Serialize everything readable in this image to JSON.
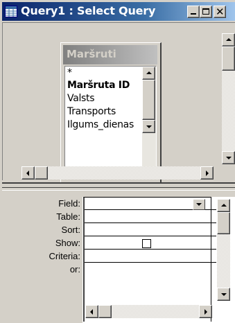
{
  "window": {
    "title": "Query1 : Select Query",
    "close_glyph": "✕"
  },
  "field_list": {
    "title": "Maršruti",
    "items": [
      {
        "label": "*",
        "bold": false
      },
      {
        "label": "Maršruta ID",
        "bold": true
      },
      {
        "label": "Valsts",
        "bold": false
      },
      {
        "label": "Transports",
        "bold": false
      },
      {
        "label": "Ilgums_dienas",
        "bold": false
      }
    ]
  },
  "grid": {
    "row_labels": [
      "Field:",
      "Table:",
      "Sort:",
      "Show:",
      "Criteria:",
      "or:"
    ],
    "show_checked": false
  },
  "colors": {
    "title_bar_start": "#0a246a",
    "title_bar_end": "#a6caf0",
    "face": "#d4d0c8"
  }
}
